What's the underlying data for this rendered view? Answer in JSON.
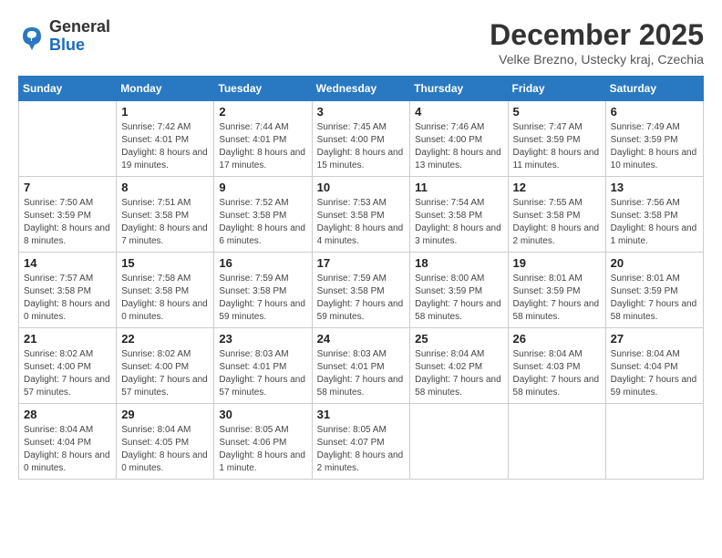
{
  "header": {
    "logo": {
      "general": "General",
      "blue": "Blue"
    },
    "month_title": "December 2025",
    "subtitle": "Velke Brezno, Ustecky kraj, Czechia"
  },
  "days_of_week": [
    "Sunday",
    "Monday",
    "Tuesday",
    "Wednesday",
    "Thursday",
    "Friday",
    "Saturday"
  ],
  "weeks": [
    [
      {
        "day": "",
        "info": ""
      },
      {
        "day": "1",
        "info": "Sunrise: 7:42 AM\nSunset: 4:01 PM\nDaylight: 8 hours and 19 minutes."
      },
      {
        "day": "2",
        "info": "Sunrise: 7:44 AM\nSunset: 4:01 PM\nDaylight: 8 hours and 17 minutes."
      },
      {
        "day": "3",
        "info": "Sunrise: 7:45 AM\nSunset: 4:00 PM\nDaylight: 8 hours and 15 minutes."
      },
      {
        "day": "4",
        "info": "Sunrise: 7:46 AM\nSunset: 4:00 PM\nDaylight: 8 hours and 13 minutes."
      },
      {
        "day": "5",
        "info": "Sunrise: 7:47 AM\nSunset: 3:59 PM\nDaylight: 8 hours and 11 minutes."
      },
      {
        "day": "6",
        "info": "Sunrise: 7:49 AM\nSunset: 3:59 PM\nDaylight: 8 hours and 10 minutes."
      }
    ],
    [
      {
        "day": "7",
        "info": "Sunrise: 7:50 AM\nSunset: 3:59 PM\nDaylight: 8 hours and 8 minutes."
      },
      {
        "day": "8",
        "info": "Sunrise: 7:51 AM\nSunset: 3:58 PM\nDaylight: 8 hours and 7 minutes."
      },
      {
        "day": "9",
        "info": "Sunrise: 7:52 AM\nSunset: 3:58 PM\nDaylight: 8 hours and 6 minutes."
      },
      {
        "day": "10",
        "info": "Sunrise: 7:53 AM\nSunset: 3:58 PM\nDaylight: 8 hours and 4 minutes."
      },
      {
        "day": "11",
        "info": "Sunrise: 7:54 AM\nSunset: 3:58 PM\nDaylight: 8 hours and 3 minutes."
      },
      {
        "day": "12",
        "info": "Sunrise: 7:55 AM\nSunset: 3:58 PM\nDaylight: 8 hours and 2 minutes."
      },
      {
        "day": "13",
        "info": "Sunrise: 7:56 AM\nSunset: 3:58 PM\nDaylight: 8 hours and 1 minute."
      }
    ],
    [
      {
        "day": "14",
        "info": "Sunrise: 7:57 AM\nSunset: 3:58 PM\nDaylight: 8 hours and 0 minutes."
      },
      {
        "day": "15",
        "info": "Sunrise: 7:58 AM\nSunset: 3:58 PM\nDaylight: 8 hours and 0 minutes."
      },
      {
        "day": "16",
        "info": "Sunrise: 7:59 AM\nSunset: 3:58 PM\nDaylight: 7 hours and 59 minutes."
      },
      {
        "day": "17",
        "info": "Sunrise: 7:59 AM\nSunset: 3:58 PM\nDaylight: 7 hours and 59 minutes."
      },
      {
        "day": "18",
        "info": "Sunrise: 8:00 AM\nSunset: 3:59 PM\nDaylight: 7 hours and 58 minutes."
      },
      {
        "day": "19",
        "info": "Sunrise: 8:01 AM\nSunset: 3:59 PM\nDaylight: 7 hours and 58 minutes."
      },
      {
        "day": "20",
        "info": "Sunrise: 8:01 AM\nSunset: 3:59 PM\nDaylight: 7 hours and 58 minutes."
      }
    ],
    [
      {
        "day": "21",
        "info": "Sunrise: 8:02 AM\nSunset: 4:00 PM\nDaylight: 7 hours and 57 minutes."
      },
      {
        "day": "22",
        "info": "Sunrise: 8:02 AM\nSunset: 4:00 PM\nDaylight: 7 hours and 57 minutes."
      },
      {
        "day": "23",
        "info": "Sunrise: 8:03 AM\nSunset: 4:01 PM\nDaylight: 7 hours and 57 minutes."
      },
      {
        "day": "24",
        "info": "Sunrise: 8:03 AM\nSunset: 4:01 PM\nDaylight: 7 hours and 58 minutes."
      },
      {
        "day": "25",
        "info": "Sunrise: 8:04 AM\nSunset: 4:02 PM\nDaylight: 7 hours and 58 minutes."
      },
      {
        "day": "26",
        "info": "Sunrise: 8:04 AM\nSunset: 4:03 PM\nDaylight: 7 hours and 58 minutes."
      },
      {
        "day": "27",
        "info": "Sunrise: 8:04 AM\nSunset: 4:04 PM\nDaylight: 7 hours and 59 minutes."
      }
    ],
    [
      {
        "day": "28",
        "info": "Sunrise: 8:04 AM\nSunset: 4:04 PM\nDaylight: 8 hours and 0 minutes."
      },
      {
        "day": "29",
        "info": "Sunrise: 8:04 AM\nSunset: 4:05 PM\nDaylight: 8 hours and 0 minutes."
      },
      {
        "day": "30",
        "info": "Sunrise: 8:05 AM\nSunset: 4:06 PM\nDaylight: 8 hours and 1 minute."
      },
      {
        "day": "31",
        "info": "Sunrise: 8:05 AM\nSunset: 4:07 PM\nDaylight: 8 hours and 2 minutes."
      },
      {
        "day": "",
        "info": ""
      },
      {
        "day": "",
        "info": ""
      },
      {
        "day": "",
        "info": ""
      }
    ]
  ]
}
